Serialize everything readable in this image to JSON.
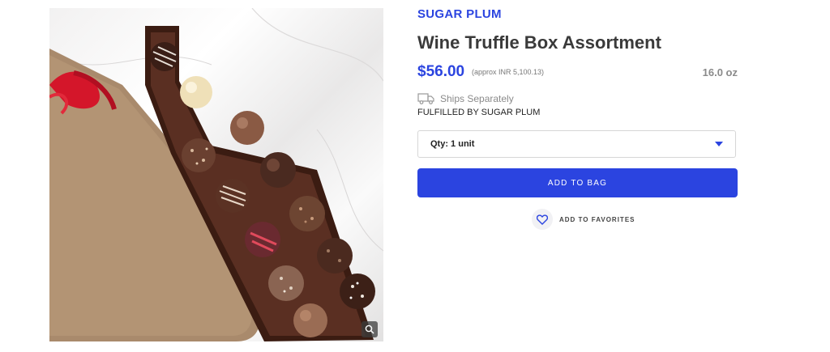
{
  "product": {
    "brand": "SUGAR PLUM",
    "title": "Wine Truffle Box Assortment",
    "price": "$56.00",
    "price_approx": "(approx INR 5,100.13)",
    "weight": "16.0 oz",
    "shipping": "Ships Separately",
    "fulfilled_by": "FULFILLED BY SUGAR PLUM",
    "quantity": "Qty: 1 unit",
    "add_to_bag": "ADD TO BAG",
    "add_to_favorites": "ADD TO FAVORITES"
  },
  "icons": {
    "shipping": "truck-icon",
    "favorite": "heart-icon",
    "zoom": "magnifier-icon",
    "quantity_dropdown": "caret-down-icon"
  },
  "colors": {
    "accent": "#2b44e0",
    "text_dark": "#3a3a3a",
    "text_muted": "#8a8a8a"
  }
}
